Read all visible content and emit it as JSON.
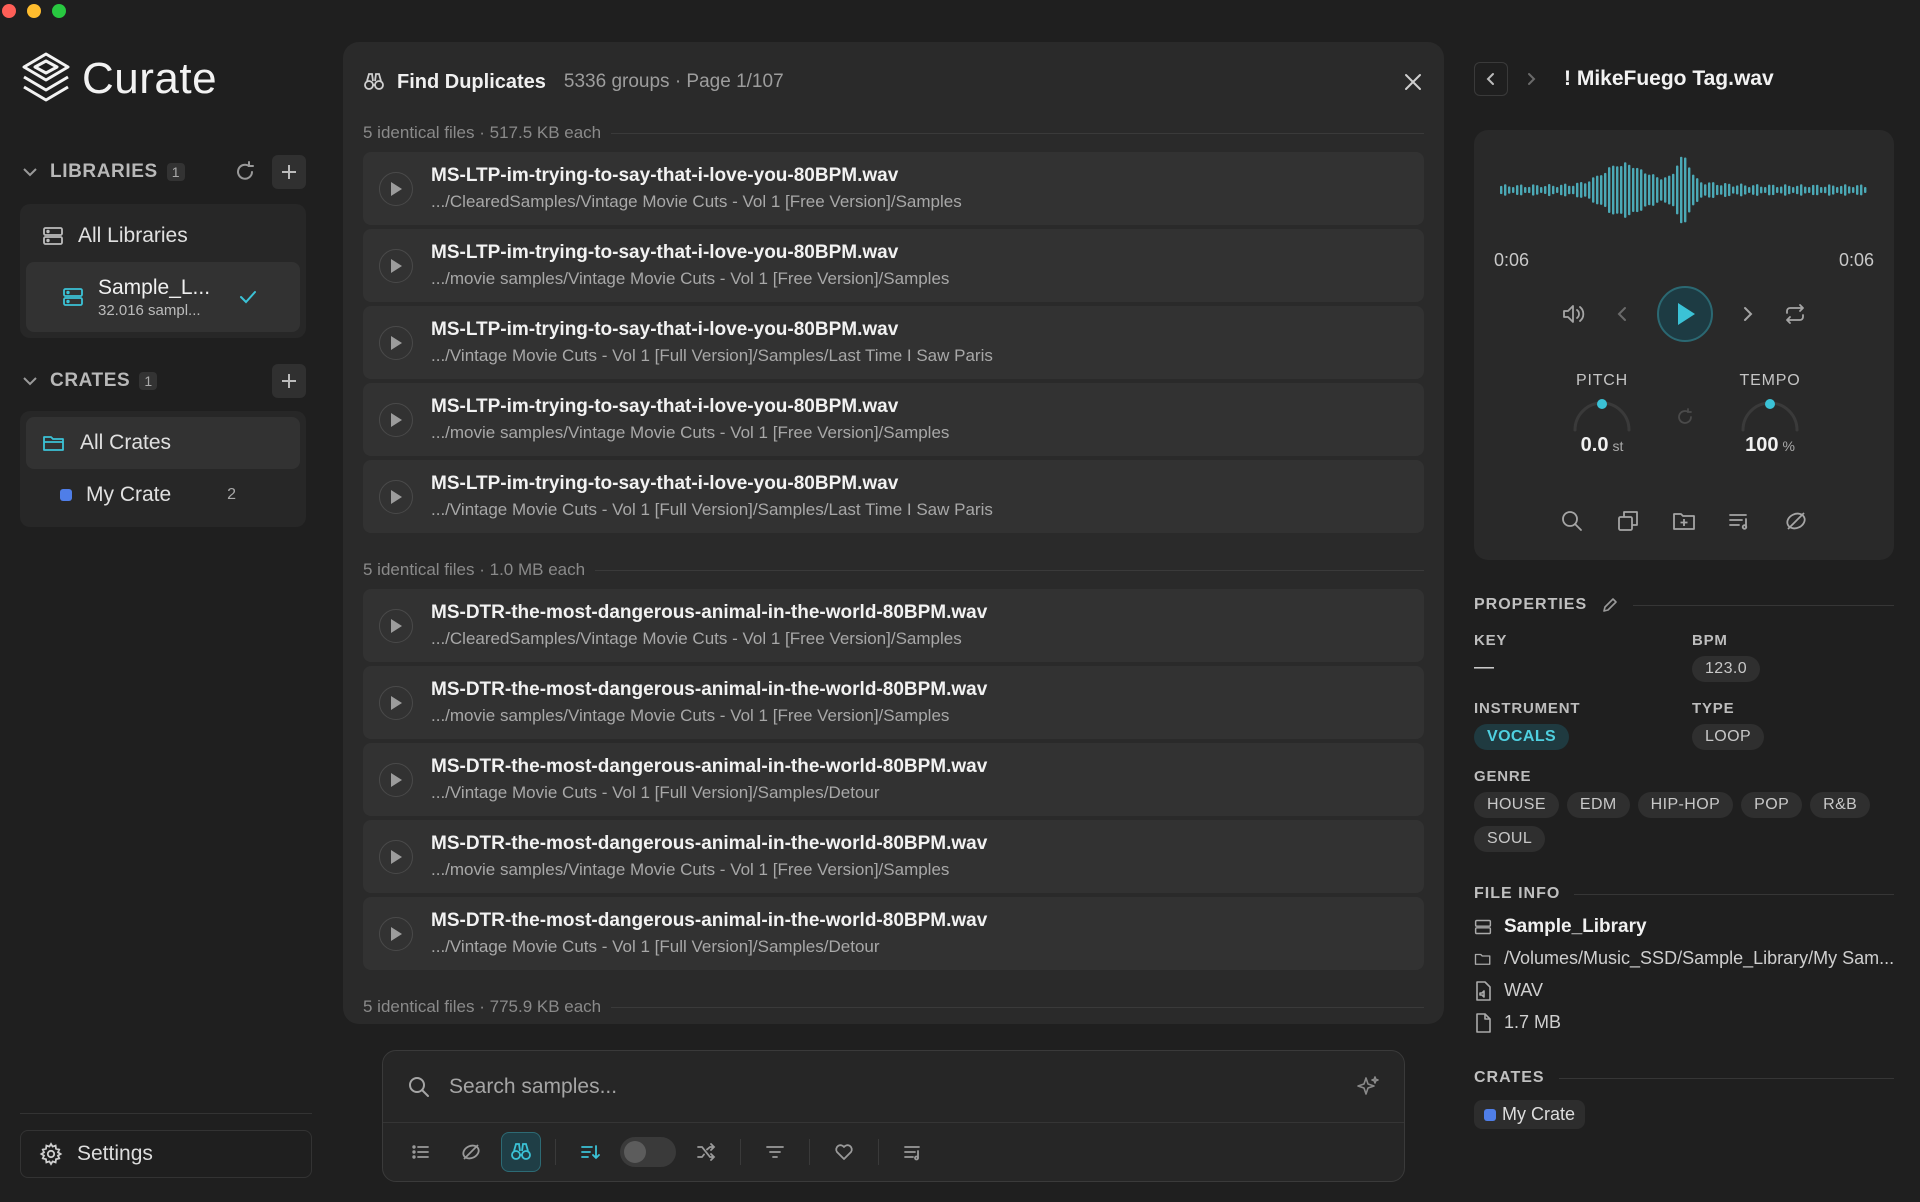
{
  "window": {
    "traffic_lights": [
      "#fe5f57",
      "#febc2e",
      "#28c840"
    ]
  },
  "app": {
    "name": "Curate"
  },
  "sidebar": {
    "libraries_title": "LIBRARIES",
    "libraries_count": "1",
    "all_libraries": "All Libraries",
    "library": {
      "name": "Sample_L...",
      "sub": "32.016 sampl..."
    },
    "crates_title": "CRATES",
    "crates_count": "1",
    "all_crates": "All Crates",
    "crate": {
      "name": "My Crate",
      "count": "2",
      "color": "#4f7ee8"
    },
    "settings": "Settings"
  },
  "duplicates": {
    "title": "Find Duplicates",
    "meta": "5336 groups · Page 1/107",
    "groups": [
      {
        "label": "5 identical files · 517.5 KB each",
        "files": [
          {
            "name": "MS-LTP-im-trying-to-say-that-i-love-you-80BPM.wav",
            "path": ".../ClearedSamples/Vintage Movie Cuts - Vol 1 [Free Version]/Samples"
          },
          {
            "name": "MS-LTP-im-trying-to-say-that-i-love-you-80BPM.wav",
            "path": ".../movie samples/Vintage Movie Cuts - Vol 1 [Free Version]/Samples"
          },
          {
            "name": "MS-LTP-im-trying-to-say-that-i-love-you-80BPM.wav",
            "path": ".../Vintage Movie Cuts - Vol 1 [Full Version]/Samples/Last Time I Saw Paris"
          },
          {
            "name": "MS-LTP-im-trying-to-say-that-i-love-you-80BPM.wav",
            "path": ".../movie samples/Vintage Movie Cuts - Vol 1 [Free Version]/Samples"
          },
          {
            "name": "MS-LTP-im-trying-to-say-that-i-love-you-80BPM.wav",
            "path": ".../Vintage Movie Cuts - Vol 1 [Full Version]/Samples/Last Time I Saw Paris"
          }
        ]
      },
      {
        "label": "5 identical files · 1.0 MB each",
        "files": [
          {
            "name": "MS-DTR-the-most-dangerous-animal-in-the-world-80BPM.wav",
            "path": ".../ClearedSamples/Vintage Movie Cuts - Vol 1 [Free Version]/Samples"
          },
          {
            "name": "MS-DTR-the-most-dangerous-animal-in-the-world-80BPM.wav",
            "path": ".../movie samples/Vintage Movie Cuts - Vol 1 [Free Version]/Samples"
          },
          {
            "name": "MS-DTR-the-most-dangerous-animal-in-the-world-80BPM.wav",
            "path": ".../Vintage Movie Cuts - Vol 1 [Full Version]/Samples/Detour"
          },
          {
            "name": "MS-DTR-the-most-dangerous-animal-in-the-world-80BPM.wav",
            "path": ".../movie samples/Vintage Movie Cuts - Vol 1 [Free Version]/Samples"
          },
          {
            "name": "MS-DTR-the-most-dangerous-animal-in-the-world-80BPM.wav",
            "path": ".../Vintage Movie Cuts - Vol 1 [Full Version]/Samples/Detour"
          }
        ]
      },
      {
        "label": "5 identical files · 775.9 KB each",
        "files": []
      }
    ]
  },
  "search": {
    "placeholder": "Search samples..."
  },
  "player": {
    "title": "! MikeFuego Tag.wav",
    "time_current": "0:06",
    "time_total": "0:06",
    "pitch_label": "PITCH",
    "pitch_value": "0.0",
    "pitch_unit": "st",
    "tempo_label": "TEMPO",
    "tempo_value": "100",
    "tempo_unit": "%",
    "accent": "#3bc2d6"
  },
  "properties": {
    "title": "PROPERTIES",
    "key_label": "KEY",
    "key_value": "—",
    "bpm_label": "BPM",
    "bpm_value": "123.0",
    "instrument_label": "INSTRUMENT",
    "instrument_value": "VOCALS",
    "type_label": "TYPE",
    "type_value": "LOOP",
    "genre_label": "GENRE",
    "genres": [
      "HOUSE",
      "EDM",
      "HIP-HOP",
      "POP",
      "R&B",
      "SOUL"
    ]
  },
  "file_info": {
    "title": "FILE INFO",
    "library": "Sample_Library",
    "path": "/Volumes/Music_SSD/Sample_Library/My Sam...",
    "format": "WAV",
    "size": "1.7 MB"
  },
  "crates_info": {
    "title": "CRATES",
    "crate": "My Crate"
  }
}
